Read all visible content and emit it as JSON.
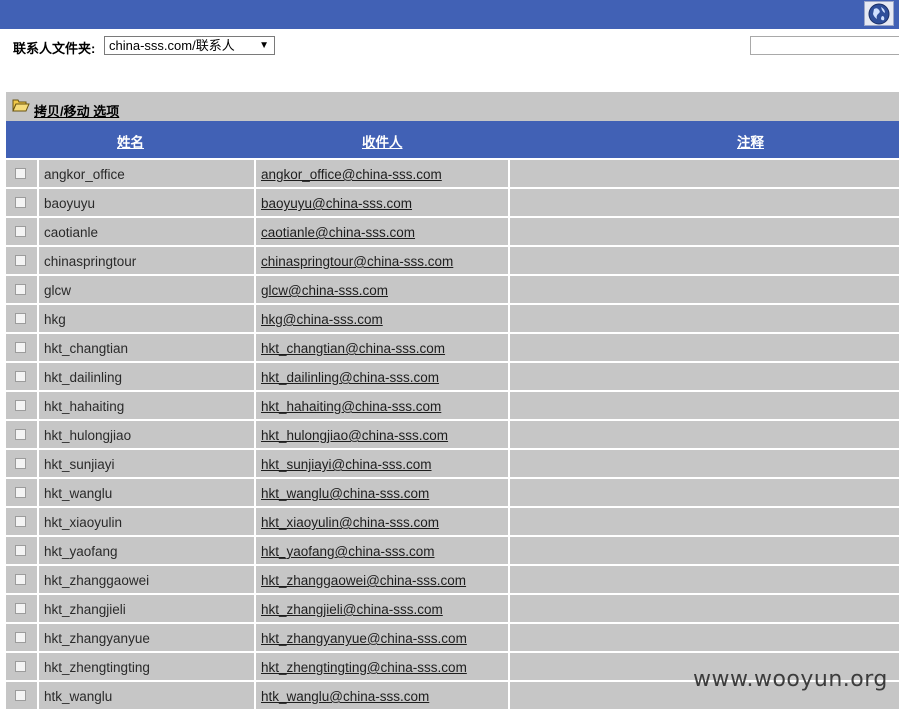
{
  "toolbar": {
    "globe_icon": "globe-icon"
  },
  "folder": {
    "label": "联系人文件夹:",
    "selected": "china-sss.com/联系人"
  },
  "search": {
    "value": ""
  },
  "options": {
    "label": "拷贝/移动 选项",
    "icon": "open-folder-icon"
  },
  "table": {
    "headers": {
      "name": "姓名",
      "recipient": "收件人",
      "note": "注释"
    },
    "rows": [
      {
        "name": "angkor_office",
        "email": "angkor_office@china-sss.com",
        "note": ""
      },
      {
        "name": "baoyuyu",
        "email": "baoyuyu@china-sss.com",
        "note": ""
      },
      {
        "name": "caotianle",
        "email": "caotianle@china-sss.com",
        "note": ""
      },
      {
        "name": "chinaspringtour",
        "email": "chinaspringtour@china-sss.com",
        "note": ""
      },
      {
        "name": "glcw",
        "email": "glcw@china-sss.com",
        "note": ""
      },
      {
        "name": "hkg",
        "email": "hkg@china-sss.com",
        "note": ""
      },
      {
        "name": "hkt_changtian",
        "email": "hkt_changtian@china-sss.com",
        "note": ""
      },
      {
        "name": "hkt_dailinling",
        "email": "hkt_dailinling@china-sss.com",
        "note": ""
      },
      {
        "name": "hkt_hahaiting",
        "email": "hkt_hahaiting@china-sss.com",
        "note": ""
      },
      {
        "name": "hkt_hulongjiao",
        "email": "hkt_hulongjiao@china-sss.com",
        "note": ""
      },
      {
        "name": "hkt_sunjiayi",
        "email": "hkt_sunjiayi@china-sss.com",
        "note": ""
      },
      {
        "name": "hkt_wanglu",
        "email": "hkt_wanglu@china-sss.com",
        "note": ""
      },
      {
        "name": "hkt_xiaoyulin",
        "email": "hkt_xiaoyulin@china-sss.com",
        "note": ""
      },
      {
        "name": "hkt_yaofang",
        "email": "hkt_yaofang@china-sss.com",
        "note": ""
      },
      {
        "name": "hkt_zhanggaowei",
        "email": "hkt_zhanggaowei@china-sss.com",
        "note": ""
      },
      {
        "name": "hkt_zhangjieli",
        "email": "hkt_zhangjieli@china-sss.com",
        "note": ""
      },
      {
        "name": "hkt_zhangyanyue",
        "email": "hkt_zhangyanyue@china-sss.com",
        "note": ""
      },
      {
        "name": "hkt_zhengtingting",
        "email": "hkt_zhengtingting@china-sss.com",
        "note": ""
      },
      {
        "name": "htk_wanglu",
        "email": "htk_wanglu@china-sss.com",
        "note": ""
      }
    ]
  },
  "watermark": "www.wooyun.org"
}
